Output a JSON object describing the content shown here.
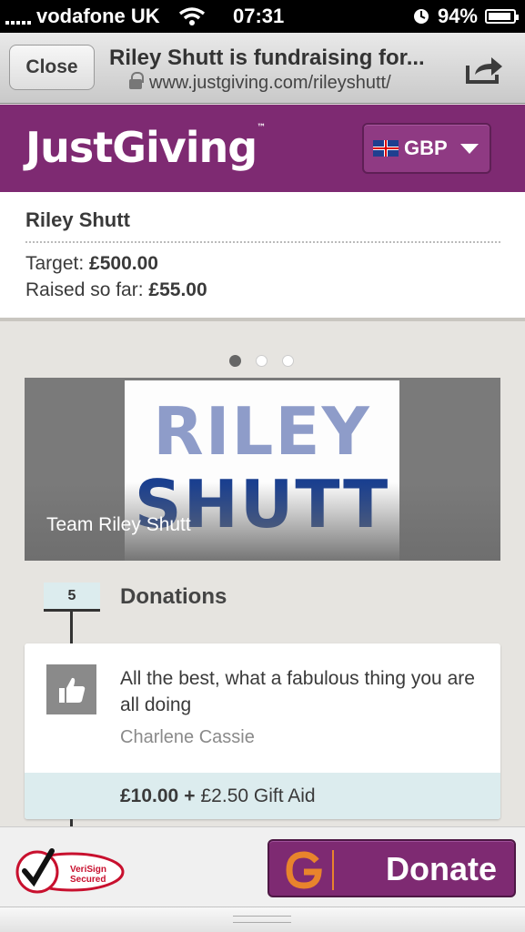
{
  "status": {
    "carrier": "vodafone UK",
    "time": "07:31",
    "battery": "94%",
    "battery_level": 0.94
  },
  "browser": {
    "close_label": "Close",
    "page_title": "Riley Shutt is fundraising for...",
    "url": "www.justgiving.com/rileyshutt/"
  },
  "header": {
    "logo": "JustGiving",
    "logo_mark": "™",
    "currency": "GBP"
  },
  "fundraiser": {
    "name": "Riley Shutt",
    "target_label": "Target:",
    "target_value": "£500.00",
    "raised_label": "Raised so far:",
    "raised_value": "£55.00"
  },
  "carousel": {
    "dots": 3,
    "active_index": 0,
    "image_line1": "RILEY",
    "image_line2": "SHUTT",
    "caption": "Team Riley Shutt"
  },
  "donations": {
    "count": "5",
    "title": "Donations",
    "items": [
      {
        "message": "All the best, what a fabulous thing you are all doing",
        "donor": "Charlene Cassie",
        "amount": "£10.00",
        "plus": "+",
        "gift_aid": "£2.50 Gift Aid"
      }
    ]
  },
  "footer": {
    "verisign_line1": "VeriSign",
    "verisign_line2": "Secured",
    "donate_label": "Donate"
  },
  "colors": {
    "brand_purple": "#7e2a72",
    "accent_orange": "#e8842c",
    "highlight_teal": "#dcecee"
  }
}
